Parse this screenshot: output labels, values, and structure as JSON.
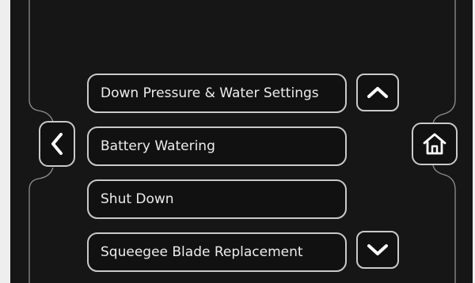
{
  "menu": {
    "items": [
      {
        "label": "Down Pressure & Water Settings"
      },
      {
        "label": "Battery Watering"
      },
      {
        "label": "Shut Down"
      },
      {
        "label": "Squeegee Blade Replacement"
      }
    ]
  },
  "icons": {
    "back": "chevron-left-icon",
    "home": "home-icon",
    "scroll_up": "chevron-up-icon",
    "scroll_down": "chevron-down-icon"
  },
  "colors": {
    "background": "#161616",
    "outline": "#c9c9c9",
    "text": "#ececec"
  }
}
